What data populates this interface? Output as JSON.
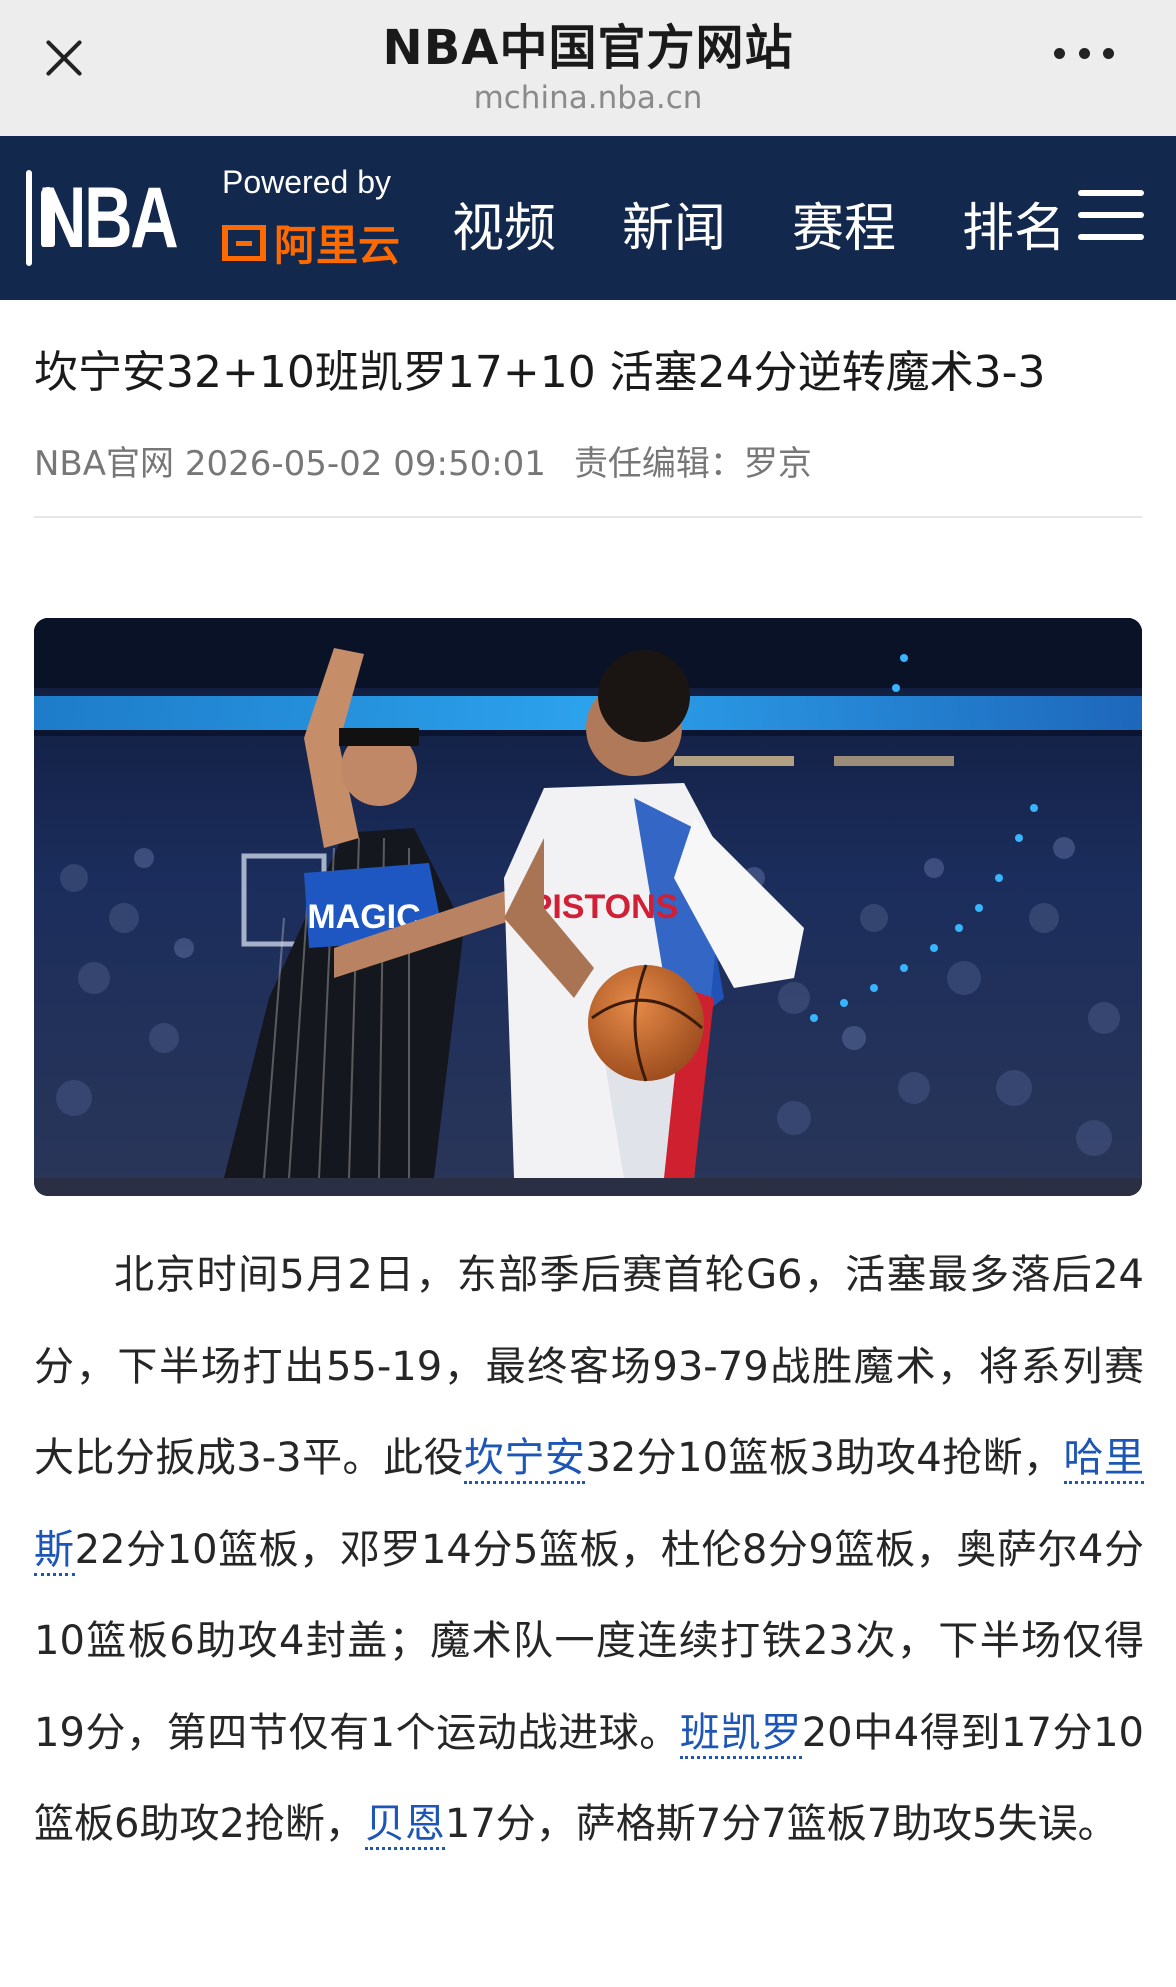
{
  "topbar": {
    "title": "NBA中国官方网站",
    "url": "mchina.nba.cn",
    "close_icon": "close-icon",
    "more_icon": "more-dots-icon"
  },
  "navbar": {
    "logo_text": "NBA",
    "powered_by": "Powered by",
    "sponsor": "阿里云",
    "items": [
      "视频",
      "新闻",
      "赛程",
      "排名"
    ],
    "menu_icon": "hamburger-icon",
    "background": "#13284d",
    "sponsor_color": "#ff6a00"
  },
  "article": {
    "headline": "坎宁安32+10班凯罗17+10 活塞24分逆转魔术3-3",
    "source": "NBA官网 2026-05-02 09:50:01",
    "editor": "责任编辑：罗京",
    "photo_jersey_home": "MAGIC",
    "photo_jersey_away": "PISTONS",
    "body": {
      "t1": "北京时间5月2日，东部季后赛首轮G6，活塞最多落后24分，下半场打出55-19，最终客场93-79战胜魔术，将系列赛大比分扳成3-3平。此役",
      "link1": "坎宁安",
      "t2": "32分10篮板3助攻4抢断，",
      "link2": "哈里斯",
      "t3": "22分10篮板，邓罗14分5篮板，杜伦8分9篮板，奥萨尔4分10篮板6助攻4封盖；魔术队一度连续打铁23次，下半场仅得19分，第四节仅有1个运动战进球。",
      "link3": "班凯罗",
      "t4": "20中4得到17分10篮板6助攻2抢断，",
      "link4": "贝恩",
      "t5": "17分，萨格斯7分7篮板7助攻5失误。"
    },
    "link_color": "#1d56b6"
  }
}
